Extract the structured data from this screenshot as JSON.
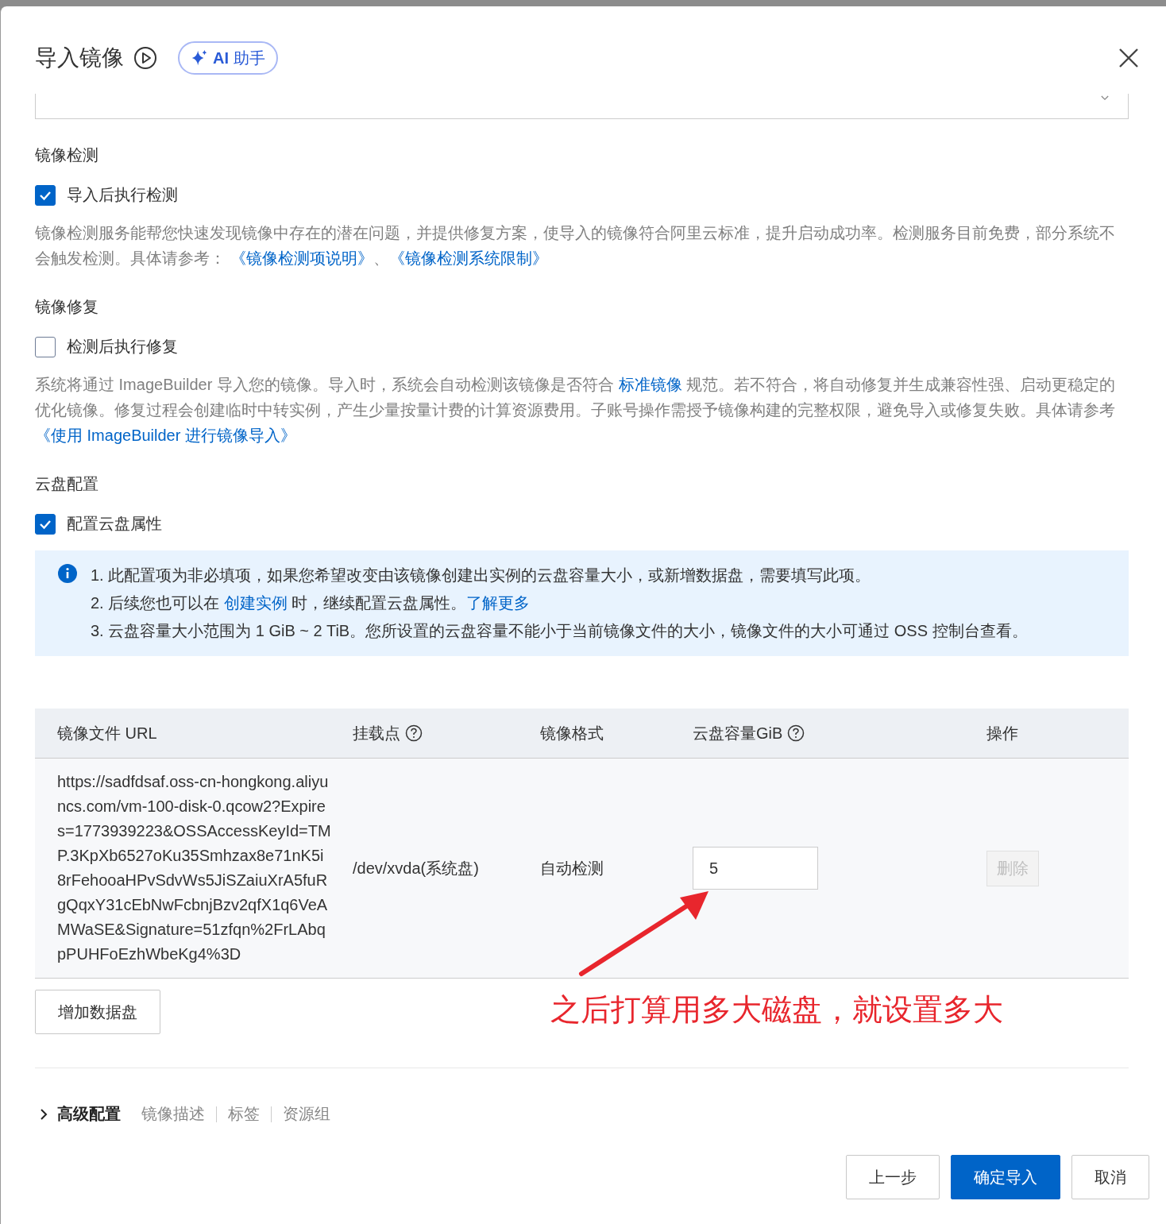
{
  "dialog": {
    "title": "导入镜像",
    "ai_button": "AI 助手"
  },
  "os_select": {
    "kind": "select"
  },
  "image_check": {
    "label": "镜像检测",
    "checkbox": {
      "label": "导入后执行检测",
      "checked": true
    },
    "description": [
      {
        "kind": "text",
        "text": "镜像检测服务能帮您快速发现镜像中存在的潜在问题，并提供修复方案，使导入的镜像符合阿里云标准，提升启动成功率。检测服务目前免费，部分系统不会触发检测。具体请参考： "
      },
      {
        "kind": "link",
        "text": "《镜像检测项说明》"
      },
      {
        "kind": "text",
        "text": "、"
      },
      {
        "kind": "link",
        "text": "《镜像检测系统限制》"
      }
    ]
  },
  "image_repair": {
    "label": "镜像修复",
    "checkbox": {
      "label": "检测后执行修复",
      "checked": false
    },
    "description": [
      {
        "kind": "text",
        "text": "系统将通过 ImageBuilder 导入您的镜像。导入时，系统会自动检测该镜像是否符合 "
      },
      {
        "kind": "link",
        "text": "标准镜像"
      },
      {
        "kind": "text",
        "text": " 规范。若不符合，将自动修复并生成兼容性强、启动更稳定的优化镜像。修复过程会创建临时中转实例，产生少量按量计费的计算资源费用。子账号操作需授予镜像构建的完整权限，避免导入或修复失败。具体请参考"
      },
      {
        "kind": "link",
        "text": "《使用 ImageBuilder 进行镜像导入》"
      }
    ]
  },
  "disk_config": {
    "label": "云盘配置",
    "checkbox": {
      "label": "配置云盘属性",
      "checked": true
    },
    "notice": [
      [
        {
          "kind": "text",
          "text": "1. 此配置项为非必填项，如果您希望改变由该镜像创建出实例的云盘容量大小，或新增数据盘，需要填写此项。"
        }
      ],
      [
        {
          "kind": "text",
          "text": "2. 后续您也可以在 "
        },
        {
          "kind": "link",
          "text": "创建实例"
        },
        {
          "kind": "text",
          "text": " 时，继续配置云盘属性。"
        },
        {
          "kind": "link",
          "text": "了解更多"
        }
      ],
      [
        {
          "kind": "text",
          "text": "3. 云盘容量大小范围为 1 GiB ~ 2 TiB。您所设置的云盘容量不能小于当前镜像文件的大小，镜像文件的大小可通过 OSS 控制台查看。"
        }
      ]
    ]
  },
  "table": {
    "columns": [
      {
        "label": "镜像文件 URL",
        "help": false
      },
      {
        "label": "挂载点",
        "help": true
      },
      {
        "label": "镜像格式",
        "help": false
      },
      {
        "label": "云盘容量GiB",
        "help": true
      },
      {
        "label": "操作",
        "help": false
      }
    ],
    "rows": [
      {
        "url": "https://sadfdsaf.oss-cn-hongkong.aliyuncs.com/vm-100-disk-0.qcow2?Expires=1773939223&OSSAccessKeyId=TMP.3KpXb6527oKu35Smhzax8e71nK5i8rFehooaHPvSdvWs5JiSZaiuXrA5fuRgQqxY31cEbNwFcbnjBzv2qfX1q6VeAMWaSE&Signature=51zfqn%2FrLAbqpPUHFoEzhWbeKg4%3D",
        "mount": "/dev/xvda(系统盘)",
        "format": "自动检测",
        "size": "5",
        "action": {
          "label": "删除",
          "disabled": true
        }
      }
    ]
  },
  "add_disk_button": "增加数据盘",
  "annotation": {
    "text": "之后打算用多大磁盘，就设置多大"
  },
  "advanced": {
    "label": "高级配置",
    "expanded": false,
    "items": [
      "镜像描述",
      "标签",
      "资源组"
    ]
  },
  "footer_buttons": [
    {
      "label": "上一步",
      "kind": "default"
    },
    {
      "label": "确定导入",
      "kind": "primary"
    },
    {
      "label": "取消",
      "kind": "default"
    }
  ]
}
